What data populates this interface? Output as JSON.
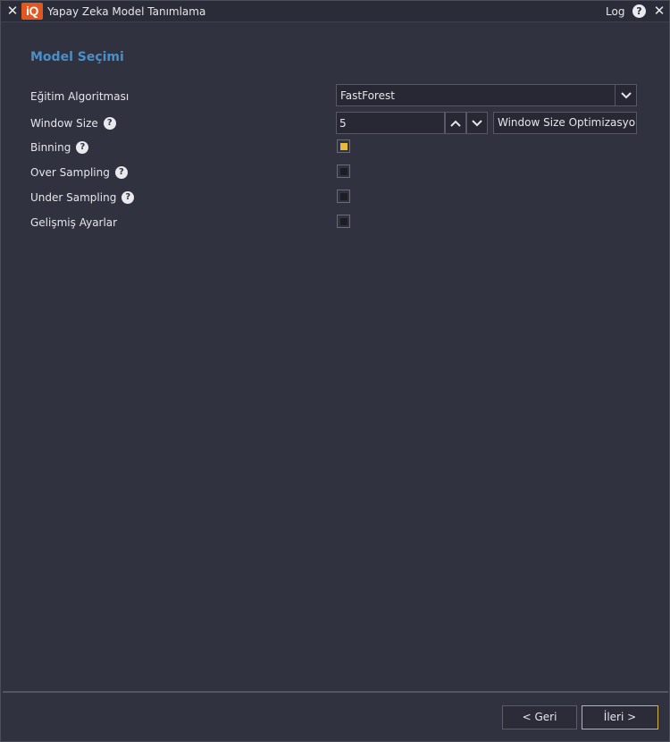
{
  "window": {
    "title": "Yapay Zeka Model Tanımlama",
    "logo_text": "iQ",
    "log_label": "Log",
    "help_symbol": "?",
    "close_symbol": "✕"
  },
  "section": {
    "title": "Model Seçimi"
  },
  "fields": {
    "algorithm": {
      "label": "Eğitim Algoritması",
      "value": "FastForest"
    },
    "window_size": {
      "label": "Window Size",
      "value": "5",
      "optimize_label": "Window Size Optimizasyonu"
    },
    "binning": {
      "label": "Binning",
      "checked": true
    },
    "over_sampling": {
      "label": "Over Sampling",
      "checked": false
    },
    "under_sampling": {
      "label": "Under Sampling",
      "checked": false
    },
    "advanced": {
      "label": "Gelişmiş Ayarlar",
      "checked": false
    }
  },
  "footer": {
    "back_label": "< Geri",
    "next_label": "İleri >"
  },
  "colors": {
    "accent_title": "#4a90c8",
    "logo": "#e2571f",
    "checkbox_checked": "#e8b93a",
    "primary_border": "#d9b548"
  },
  "icons": [
    "close-icon",
    "logo-icon",
    "help-icon",
    "chevron-down-icon",
    "chevron-up-icon"
  ]
}
